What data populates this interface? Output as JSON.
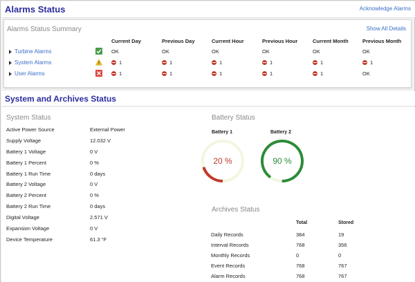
{
  "alarms": {
    "title": "Alarms Status",
    "acknowledge_label": "Acknowledge Alarms",
    "summary_title": "Alarms Status Summary",
    "show_details_label": "Show All Details",
    "columns": [
      "Current Day",
      "Previous Day",
      "Current Hour",
      "Previous Hour",
      "Current Month",
      "Previous Month"
    ],
    "rows": [
      {
        "name": "Turbine Alarms",
        "status": "ok",
        "icon": "check-icon",
        "cells": [
          {
            "err": false,
            "text": "OK"
          },
          {
            "err": false,
            "text": "OK"
          },
          {
            "err": false,
            "text": "OK"
          },
          {
            "err": false,
            "text": "OK"
          },
          {
            "err": false,
            "text": "OK"
          },
          {
            "err": false,
            "text": "OK"
          }
        ]
      },
      {
        "name": "System Alarms",
        "status": "warning",
        "icon": "warning-icon",
        "cells": [
          {
            "err": true,
            "text": "1"
          },
          {
            "err": true,
            "text": "1"
          },
          {
            "err": true,
            "text": "1"
          },
          {
            "err": true,
            "text": "1"
          },
          {
            "err": true,
            "text": "1"
          },
          {
            "err": true,
            "text": "1"
          }
        ]
      },
      {
        "name": "User Alarms",
        "status": "error",
        "icon": "error-icon",
        "cells": [
          {
            "err": true,
            "text": "1"
          },
          {
            "err": true,
            "text": "1"
          },
          {
            "err": true,
            "text": "1"
          },
          {
            "err": true,
            "text": "1"
          },
          {
            "err": true,
            "text": "1"
          },
          {
            "err": false,
            "text": "OK"
          }
        ]
      }
    ]
  },
  "system_archives": {
    "title": "System and Archives Status",
    "system_status": {
      "title": "System Status",
      "items": [
        {
          "label": "Active Power Source",
          "value": "External Power"
        },
        {
          "label": "Supply Voltage",
          "value": "12.032  V"
        },
        {
          "label": "Battery 1 Voltage",
          "value": "0  V"
        },
        {
          "label": "Battery 1 Percent",
          "value": "0  %"
        },
        {
          "label": "Battery 1 Run Time",
          "value": "0  days"
        },
        {
          "label": "Battery 2 Voltage",
          "value": "0  V"
        },
        {
          "label": "Battery 2 Percent",
          "value": "0  %"
        },
        {
          "label": "Battery 2 Run Time",
          "value": "0  days"
        },
        {
          "label": "Digital Voltage",
          "value": "2.571  V"
        },
        {
          "label": "Expansion Voltage",
          "value": "0  V"
        },
        {
          "label": "Device Temperature",
          "value": "61.3  °F"
        }
      ]
    },
    "battery_status": {
      "title": "Battery Status",
      "batteries": [
        {
          "name": "Battery 1",
          "percent": 20,
          "label": "20 %",
          "color": "#c0392b"
        },
        {
          "name": "Battery 2",
          "percent": 90,
          "label": "90 %",
          "color": "#2e8b3a"
        }
      ],
      "track_color": "#f3f6e0"
    },
    "archives_status": {
      "title": "Archives Status",
      "columns": [
        "Total",
        "Stored"
      ],
      "rows": [
        {
          "label": "Daily Records",
          "total": "384",
          "stored": "19"
        },
        {
          "label": "Interval Records",
          "total": "768",
          "stored": "356"
        },
        {
          "label": "Monthly Records",
          "total": "0",
          "stored": "0"
        },
        {
          "label": "Event Records",
          "total": "768",
          "stored": "767"
        },
        {
          "label": "Alarm Records",
          "total": "768",
          "stored": "767"
        }
      ]
    }
  }
}
